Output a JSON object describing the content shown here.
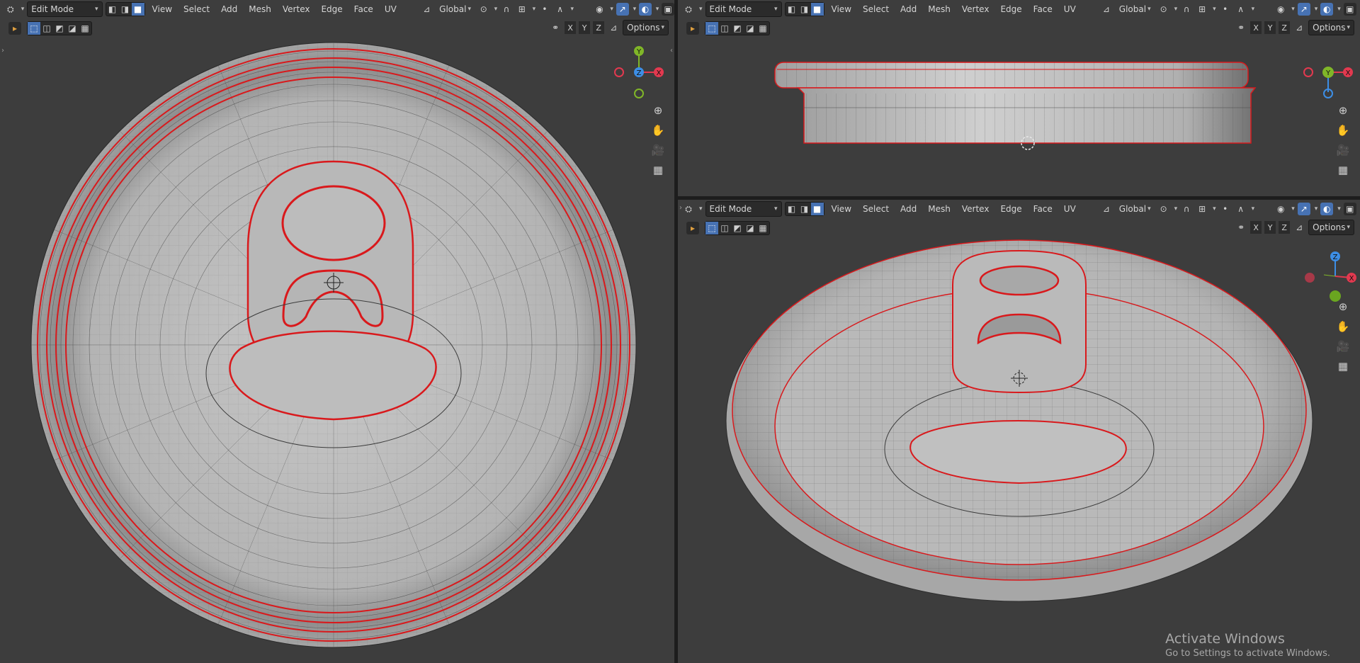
{
  "header": {
    "mode": "Edit Mode",
    "menus": [
      "View",
      "Select",
      "Add",
      "Mesh",
      "Vertex",
      "Edge",
      "Face",
      "UV"
    ],
    "orientation": "Global",
    "options": "Options",
    "axes": [
      "X",
      "Y",
      "Z"
    ]
  },
  "gizmo_labels": {
    "x": "X",
    "y": "Y",
    "z": "Z"
  },
  "colors": {
    "viewport_bg": "#3d3d3d",
    "accent": "#4772b3",
    "axis_x": "#e2394f",
    "axis_y": "#80b628",
    "axis_z": "#3d8ee5",
    "seam": "#d9191c"
  },
  "icons": [
    "editor-type-icon",
    "select-box-icon",
    "vertex-select-icon",
    "edge-select-icon",
    "face-select-icon",
    "orientation-icon",
    "pivot-icon",
    "snap-icon",
    "proportional-icon",
    "overlay-icon",
    "xray-icon",
    "zoom-icon",
    "pan-icon",
    "camera-icon",
    "grid-icon",
    "mirror-icon"
  ],
  "watermark": {
    "title": "Activate Windows",
    "subtitle": "Go to Settings to activate Windows."
  }
}
